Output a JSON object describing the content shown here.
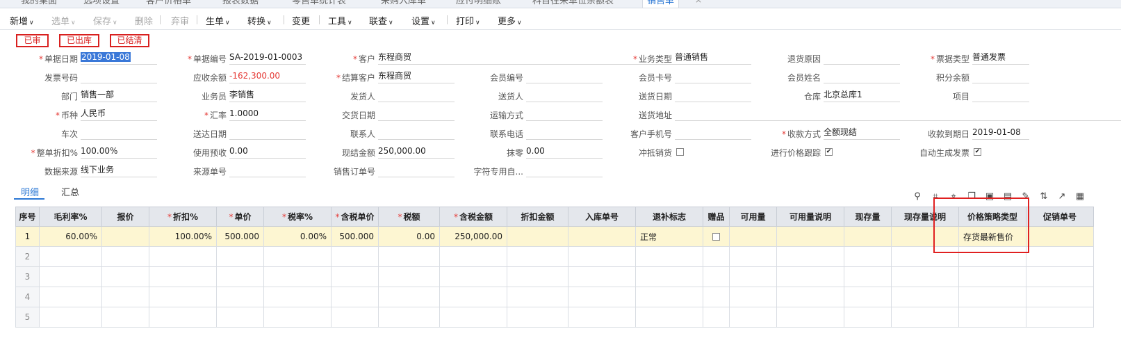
{
  "tabbar": {
    "tabs": [
      "我的桌面",
      "选项设置",
      "客户价格单",
      "报表数据",
      "零售单统计表",
      "采购入库单",
      "应付明细账",
      "科目往来单位余额表",
      "销售单"
    ],
    "close_icon": "×"
  },
  "toolbar": {
    "items": [
      {
        "label": "新增",
        "caret": true,
        "disabled": false
      },
      {
        "label": "选单",
        "caret": true,
        "disabled": true
      },
      {
        "label": "保存",
        "caret": true,
        "disabled": true
      },
      {
        "label": "删除",
        "caret": false,
        "disabled": true
      },
      {
        "label": "弃审",
        "caret": false,
        "disabled": true
      },
      {
        "label": "生单",
        "caret": true,
        "disabled": false
      },
      {
        "label": "转换",
        "caret": true,
        "disabled": false
      },
      {
        "label": "变更",
        "caret": false,
        "disabled": false
      },
      {
        "label": "工具",
        "caret": true,
        "disabled": false
      },
      {
        "label": "联查",
        "caret": true,
        "disabled": false
      },
      {
        "label": "设置",
        "caret": true,
        "disabled": false
      },
      {
        "label": "打印",
        "caret": true,
        "disabled": false
      },
      {
        "label": "更多",
        "caret": true,
        "disabled": false
      }
    ],
    "caret_icon": "∨"
  },
  "stamps": [
    "已审",
    "已出库",
    "已结清"
  ],
  "fields": [
    {
      "label": "单据日期",
      "required": true,
      "value": "2019-01-08",
      "selected": true
    },
    {
      "label": "单据编号",
      "required": true,
      "value": "SA-2019-01-0003"
    },
    {
      "label": "客户",
      "required": true,
      "value": "东程商贸"
    },
    {
      "label": "业务类型",
      "required": true,
      "value": "普通销售"
    },
    {
      "label": "退货原因",
      "required": false,
      "value": ""
    },
    {
      "label": "票据类型",
      "required": true,
      "value": "普通发票"
    },
    {
      "label": "发票号码",
      "required": false,
      "value": ""
    },
    {
      "label": "应收余额",
      "required": false,
      "value": "-162,300.00",
      "red": true
    },
    {
      "label": "结算客户",
      "required": true,
      "value": "东程商贸"
    },
    {
      "label": "会员编号",
      "required": false,
      "value": ""
    },
    {
      "label": "会员卡号",
      "required": false,
      "value": ""
    },
    {
      "label": "会员姓名",
      "required": false,
      "value": ""
    },
    {
      "label": "积分余额",
      "required": false,
      "value": ""
    },
    {
      "label": "部门",
      "required": false,
      "value": "销售一部"
    },
    {
      "label": "业务员",
      "required": false,
      "value": "李销售"
    },
    {
      "label": "发货人",
      "required": false,
      "value": ""
    },
    {
      "label": "送货人",
      "required": false,
      "value": ""
    },
    {
      "label": "送货日期",
      "required": false,
      "value": ""
    },
    {
      "label": "仓库",
      "required": false,
      "value": "北京总库1"
    },
    {
      "label": "项目",
      "required": false,
      "value": ""
    },
    {
      "label": "币种",
      "required": true,
      "value": "人民币"
    },
    {
      "label": "汇率",
      "required": true,
      "value": "1.0000"
    },
    {
      "label": "交货日期",
      "required": false,
      "value": ""
    },
    {
      "label": "运输方式",
      "required": false,
      "value": ""
    },
    {
      "label": "送货地址",
      "required": false,
      "value": ""
    },
    {
      "label": "车次",
      "required": false,
      "value": ""
    },
    {
      "label": "送达日期",
      "required": false,
      "value": ""
    },
    {
      "label": "联系人",
      "required": false,
      "value": ""
    },
    {
      "label": "联系电话",
      "required": false,
      "value": ""
    },
    {
      "label": "客户手机号",
      "required": false,
      "value": ""
    },
    {
      "label": "收款方式",
      "required": true,
      "value": "全额现结"
    },
    {
      "label": "收款到期日",
      "required": false,
      "value": "2019-01-08"
    },
    {
      "label": "整单折扣%",
      "required": true,
      "value": "100.00%"
    },
    {
      "label": "使用预收",
      "required": false,
      "value": "0.00"
    },
    {
      "label": "现结金额",
      "required": false,
      "value": "250,000.00"
    },
    {
      "label": "抹零",
      "required": false,
      "value": "0.00"
    },
    {
      "label": "数据来源",
      "required": false,
      "value": "线下业务"
    },
    {
      "label": "来源单号",
      "required": false,
      "value": ""
    },
    {
      "label": "销售订单号",
      "required": false,
      "value": ""
    },
    {
      "label": "字符专用自...",
      "required": false,
      "value": ""
    }
  ],
  "checkboxes": [
    {
      "label": "冲抵销货",
      "checked": false
    },
    {
      "label": "进行价格跟踪",
      "checked": true
    },
    {
      "label": "自动生成发票",
      "checked": true
    }
  ],
  "check_mark": "✔",
  "subtabs": [
    "明细",
    "汇总"
  ],
  "toolbar_icons": [
    "pin-icon",
    "scan-icon",
    "location-icon",
    "copy-icon",
    "paste-icon",
    "clipboard-icon",
    "edit-icon",
    "split-icon",
    "chart-icon",
    "grid-icon"
  ],
  "grid": {
    "columns": [
      {
        "label": "序号",
        "required": false
      },
      {
        "label": "毛利率%",
        "required": false
      },
      {
        "label": "报价",
        "required": false
      },
      {
        "label": "折扣%",
        "required": true
      },
      {
        "label": "单价",
        "required": true
      },
      {
        "label": "税率%",
        "required": true
      },
      {
        "label": "含税单价",
        "required": true
      },
      {
        "label": "税额",
        "required": true
      },
      {
        "label": "含税金额",
        "required": true
      },
      {
        "label": "折扣金额",
        "required": false
      },
      {
        "label": "入库单号",
        "required": false
      },
      {
        "label": "退补标志",
        "required": false
      },
      {
        "label": "赠品",
        "required": false
      },
      {
        "label": "可用量",
        "required": false
      },
      {
        "label": "可用量说明",
        "required": false
      },
      {
        "label": "现存量",
        "required": false
      },
      {
        "label": "现存量说明",
        "required": false
      },
      {
        "label": "价格策略类型",
        "required": false
      },
      {
        "label": "促销单号",
        "required": false
      }
    ],
    "rows": [
      {
        "idx": "1",
        "cells": [
          "60.00%",
          "",
          "100.00%",
          "500.000",
          "0.00%",
          "500.000",
          "0.00",
          "250,000.00",
          "",
          "",
          "正常",
          "",
          "",
          "",
          "",
          "",
          "存货最新售价",
          ""
        ]
      },
      {
        "idx": "2",
        "cells": [
          "",
          "",
          "",
          "",
          "",
          "",
          "",
          "",
          "",
          "",
          "",
          "",
          "",
          "",
          "",
          "",
          "",
          ""
        ]
      },
      {
        "idx": "3",
        "cells": [
          "",
          "",
          "",
          "",
          "",
          "",
          "",
          "",
          "",
          "",
          "",
          "",
          "",
          "",
          "",
          "",
          "",
          ""
        ]
      },
      {
        "idx": "4",
        "cells": [
          "",
          "",
          "",
          "",
          "",
          "",
          "",
          "",
          "",
          "",
          "",
          "",
          "",
          "",
          "",
          "",
          "",
          ""
        ]
      },
      {
        "idx": "5",
        "cells": [
          "",
          "",
          "",
          "",
          "",
          "",
          "",
          "",
          "",
          "",
          "",
          "",
          "",
          "",
          "",
          "",
          "",
          ""
        ]
      }
    ]
  }
}
